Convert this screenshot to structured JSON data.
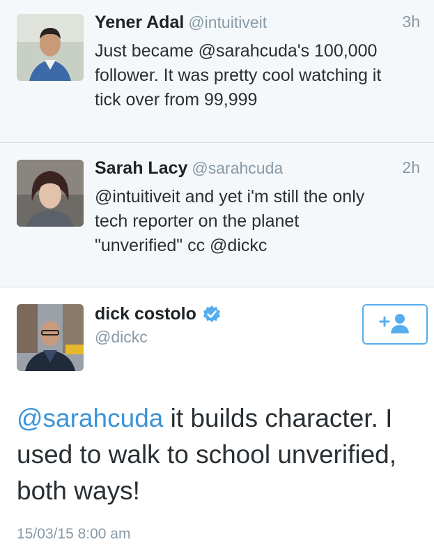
{
  "replies": [
    {
      "display_name": "Yener Adal",
      "handle": "@intuitiveit",
      "time": "3h",
      "text_lines": [
        "Just became @sarahcuda's 100,000",
        "follower. It was pretty cool watching it",
        "tick over from 99,999"
      ]
    },
    {
      "display_name": "Sarah Lacy",
      "handle": "@sarahcuda",
      "time": "2h",
      "text_lines": [
        "@intuitiveit and yet i'm still the only",
        "tech reporter on the planet",
        "\"unverified\" cc @dickc"
      ]
    }
  ],
  "main_tweet": {
    "display_name": "dick costolo",
    "handle": "@dickc",
    "verified": true,
    "follow_icon": "add-user-icon",
    "text_mention": "@sarahcuda",
    "text_line1_rest": " it builds character. I",
    "text_line2": "used to walk to school unverified,",
    "text_line3": "both ways!",
    "timestamp": "15/03/15 8:00 am"
  },
  "colors": {
    "accent": "#55acee",
    "mention": "#3b94d9",
    "secondary_text": "#8899a6",
    "reply_bg": "#f5f8fa"
  }
}
